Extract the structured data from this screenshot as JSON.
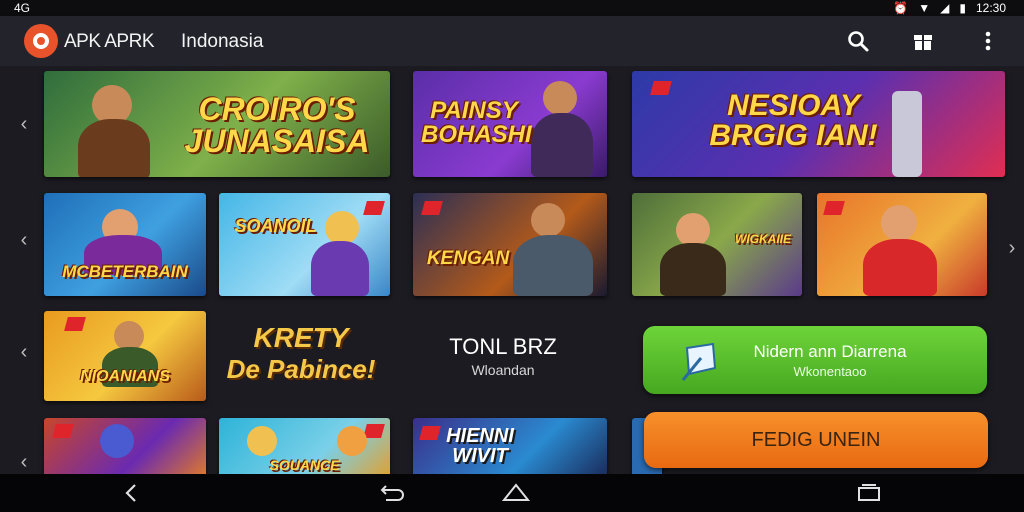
{
  "statusbar": {
    "left_text": "4G",
    "time": "12:30"
  },
  "appbar": {
    "app_name": "APK APRK",
    "region": "Indonasia"
  },
  "icons": {
    "logo": "app-logo-icon",
    "search": "search-icon",
    "gift": "gift-icon",
    "menu": "overflow-menu-icon"
  },
  "rows": [
    {
      "cards": [
        {
          "title": "CROIRO'S JUNASAISA",
          "theme": "#2f6d3c"
        },
        {
          "title": "PAINSY BOHASHI",
          "theme": "#5a2ea8"
        },
        {
          "title": "NESIOAY BRGIG IAN!",
          "theme": "#2d3aa8"
        }
      ]
    },
    {
      "cards": [
        {
          "title": "MCBETERBAIN",
          "theme": "#1f6fb8"
        },
        {
          "title": "SOANOIL",
          "theme": "#44b6e6"
        },
        {
          "title": "KENGAN",
          "theme": "#2c2f55"
        },
        {
          "title": "WIGKAIIE",
          "theme": "#4e6f3a"
        },
        {
          "title": "",
          "theme": "#e8742a"
        }
      ]
    },
    {
      "cards": [
        {
          "title": "NIOANIANS",
          "theme": "#e99a1f"
        }
      ]
    },
    {
      "cards": [
        {
          "title": "",
          "theme": "#c8462a"
        },
        {
          "title": "SOUANCE",
          "theme": "#2db3d8"
        },
        {
          "title": "HIENNI WIVIT",
          "theme": "#3a2f8a"
        }
      ]
    }
  ],
  "promo_text": {
    "line1": "KRETY",
    "line2": "De Pabince!"
  },
  "tonl_text": {
    "title": "TONL BRZ",
    "subtitle": "Wloandan"
  },
  "green_button": {
    "title": "Nidern ann Diarrena",
    "subtitle": "Wkonentaoo",
    "color": "#59c22a"
  },
  "orange_button": {
    "label": "FEDIG UNEIN",
    "color": "#f07a1a"
  },
  "navbar": {
    "back": "back-icon",
    "return": "return-icon",
    "home": "home-icon",
    "recents": "recents-icon"
  }
}
